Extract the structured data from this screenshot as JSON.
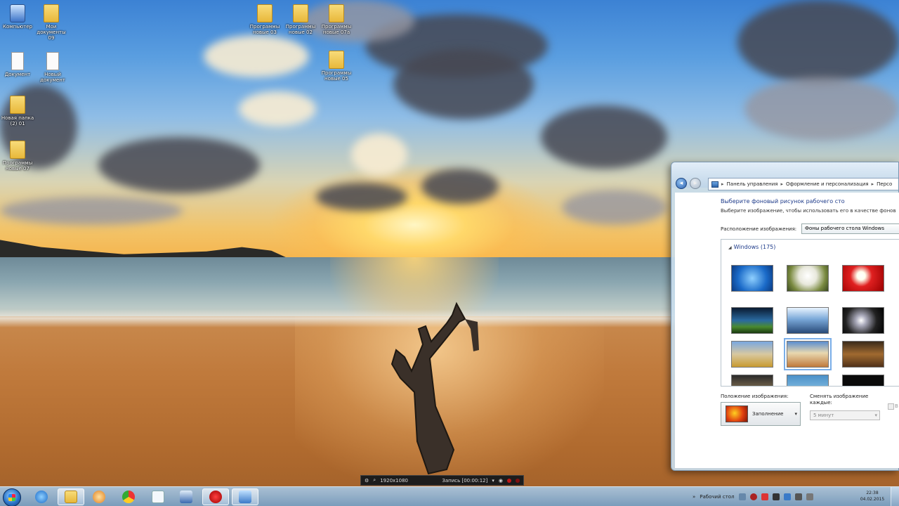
{
  "desktop": {
    "icons": [
      {
        "label": "Компьютер",
        "type": "computer"
      },
      {
        "label": "Мои документы\n09",
        "type": "folder"
      },
      {
        "label": "Документ",
        "type": "doc"
      },
      {
        "label": "Новый\nдокумент",
        "type": "doc"
      },
      {
        "label": "Новая папка\n(2) 01",
        "type": "folder"
      },
      {
        "label": "Программы\nновые 07",
        "type": "folder"
      },
      {
        "label": "Программы\nновые 03",
        "type": "folder"
      },
      {
        "label": "Программы\nновые 02",
        "type": "folder"
      },
      {
        "label": "Программы\nновые 07a",
        "type": "folder"
      },
      {
        "label": "Программы\nновые 05",
        "type": "folder"
      }
    ]
  },
  "window": {
    "breadcrumb": [
      "Панель управления",
      "Оформление и персонализация",
      "Персо"
    ],
    "heading": "Выберите фоновый рисунок рабочего сто",
    "subheading": "Выберите изображение, чтобы использовать его в качестве фонов",
    "location_label": "Расположение изображения:",
    "location_value": "Фоны рабочего стола Windows",
    "group_title": "Windows (175)",
    "position_label": "Положение изображения:",
    "position_value": "Заполнение",
    "interval_label": "Сменять изображение\nкаждые:",
    "interval_value": "5 минут",
    "shuffle_label": "В"
  },
  "recorder": {
    "resolution": "1920x1080",
    "status": "Запись [00:00:12]"
  },
  "taskbar": {
    "tray_label": "Рабочий стол",
    "clock_time": "22:38",
    "clock_date": "04.02.2015",
    "buttons": [
      "start",
      "ie",
      "explorer",
      "media-player",
      "chrome",
      "notepad",
      "network",
      "record",
      "remote"
    ]
  },
  "colors": {
    "accent": "#1e3b8a",
    "taskbar": "#8fb4d6",
    "record": "#c01818"
  }
}
